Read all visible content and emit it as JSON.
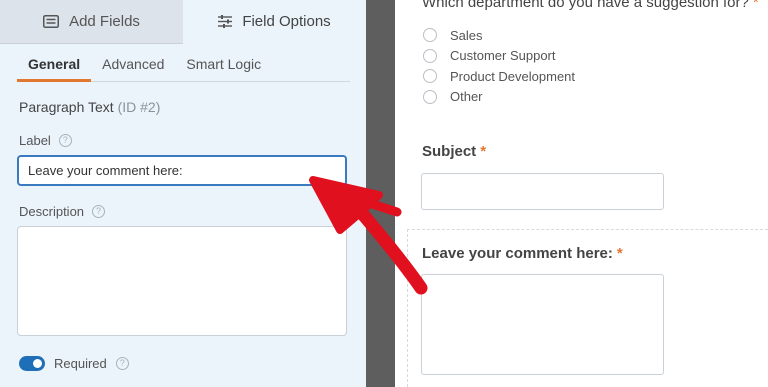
{
  "builder": {
    "tabs": {
      "add_fields": "Add Fields",
      "field_options": "Field Options"
    },
    "subtabs": [
      "General",
      "Advanced",
      "Smart Logic"
    ],
    "field_type": "Paragraph Text",
    "field_id": "(ID #2)",
    "label_title": "Label",
    "label_value": "Leave your comment here:",
    "description_title": "Description",
    "required_label": "Required",
    "help_glyph": "?"
  },
  "preview": {
    "question": "Which department do you have a suggestion for?",
    "options": [
      "Sales",
      "Customer Support",
      "Product Development",
      "Other"
    ],
    "subject_label": "Subject",
    "comment_label": "Leave your comment here:",
    "required_marker": "*"
  },
  "colors": {
    "accent_orange": "#e27730",
    "active_input_border": "#3a7bc0",
    "toggle_on": "#1f6fb8",
    "annotation_arrow": "#e0101f"
  }
}
